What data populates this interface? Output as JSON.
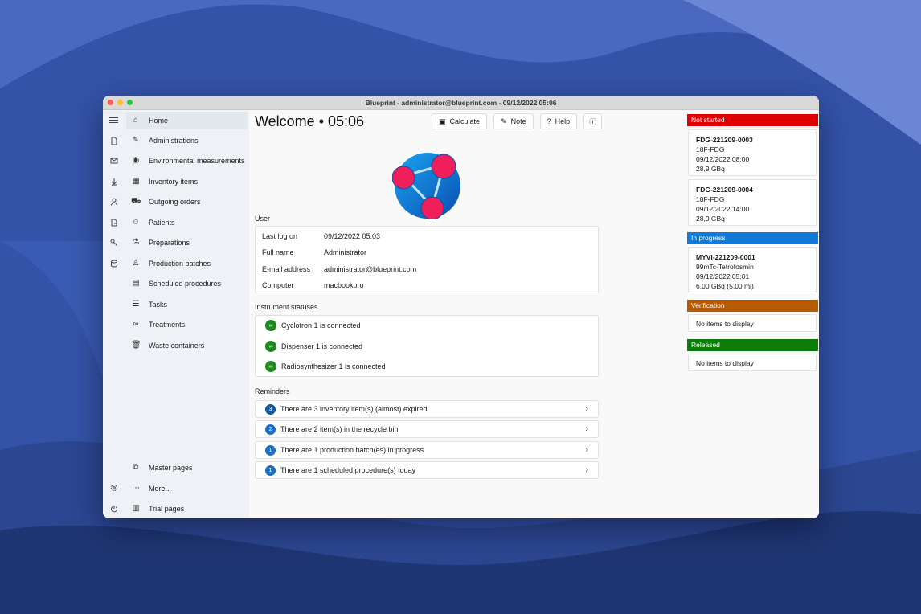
{
  "window": {
    "title": "Blueprint - administrator@blueprint.com - 09/12/2022 05:06"
  },
  "rail": [
    "menu-icon",
    "document-icon",
    "mail-icon",
    "download-icon",
    "person-icon",
    "file-export-icon",
    "key-icon",
    "database-icon",
    "settings-icon",
    "power-icon"
  ],
  "nav": {
    "items": [
      {
        "label": "Home",
        "icon": "home-icon"
      },
      {
        "label": "Administrations",
        "icon": "syringe-icon"
      },
      {
        "label": "Environmental measurements",
        "icon": "globe-icon"
      },
      {
        "label": "Inventory items",
        "icon": "boxes-icon"
      },
      {
        "label": "Outgoing orders",
        "icon": "cart-icon"
      },
      {
        "label": "Patients",
        "icon": "people-icon"
      },
      {
        "label": "Preparations",
        "icon": "flask-icon"
      },
      {
        "label": "Production batches",
        "icon": "production-icon"
      },
      {
        "label": "Scheduled procedures",
        "icon": "calendar-icon"
      },
      {
        "label": "Tasks",
        "icon": "tasks-icon"
      },
      {
        "label": "Treatments",
        "icon": "link-icon"
      },
      {
        "label": "Waste containers",
        "icon": "trash-icon"
      }
    ],
    "bottom": [
      {
        "label": "Master pages",
        "icon": "master-icon"
      },
      {
        "label": "More...",
        "icon": "more-icon"
      },
      {
        "label": "Trial pages",
        "icon": "trial-icon"
      }
    ]
  },
  "main": {
    "welcome": "Welcome • 05:06",
    "toolbar": {
      "calculate": "Calculate",
      "note": "Note",
      "help": "Help"
    },
    "user_label": "User",
    "user": [
      {
        "key": "Last log on",
        "value": "09/12/2022 05:03"
      },
      {
        "key": "Full name",
        "value": "Administrator"
      },
      {
        "key": "E-mail address",
        "value": "administrator@blueprint.com"
      },
      {
        "key": "Computer",
        "value": "macbookpro"
      }
    ],
    "instrument_label": "Instrument statuses",
    "instruments": [
      "Cyclotron 1 is connected",
      "Dispenser 1 is connected",
      "Radiosynthesizer 1 is connected"
    ],
    "reminders_label": "Reminders",
    "reminders": [
      {
        "count": "3",
        "text": "There are 3 inventory item(s) (almost) expired"
      },
      {
        "count": "2",
        "text": "There are 2 item(s) in the recycle bin"
      },
      {
        "count": "1",
        "text": "There are 1 production batch(es) in progress"
      },
      {
        "count": "1",
        "text": "There are 1 scheduled procedure(s) today"
      }
    ]
  },
  "right": {
    "not_started": {
      "label": "Not started",
      "color": "#e00000",
      "items": [
        {
          "id": "FDG-221209-0003",
          "product": "18F-FDG",
          "time": "09/12/2022 08:00",
          "activity": "28,9 GBq"
        },
        {
          "id": "FDG-221209-0004",
          "product": "18F-FDG",
          "time": "09/12/2022 14:00",
          "activity": "28,9 GBq"
        }
      ]
    },
    "in_progress": {
      "label": "In progress",
      "color": "#0f7ad8",
      "items": [
        {
          "id": "MYVI-221209-0001",
          "product": "99mTc-Tetrofosmin",
          "time": "09/12/2022 05:01",
          "activity": "6,00 GBq (5,00 ml)"
        }
      ]
    },
    "verification": {
      "label": "Verification",
      "color": "#b85a00",
      "empty": "No items to display"
    },
    "released": {
      "label": "Released",
      "color": "#0a7d0a",
      "empty": "No items to display"
    }
  }
}
